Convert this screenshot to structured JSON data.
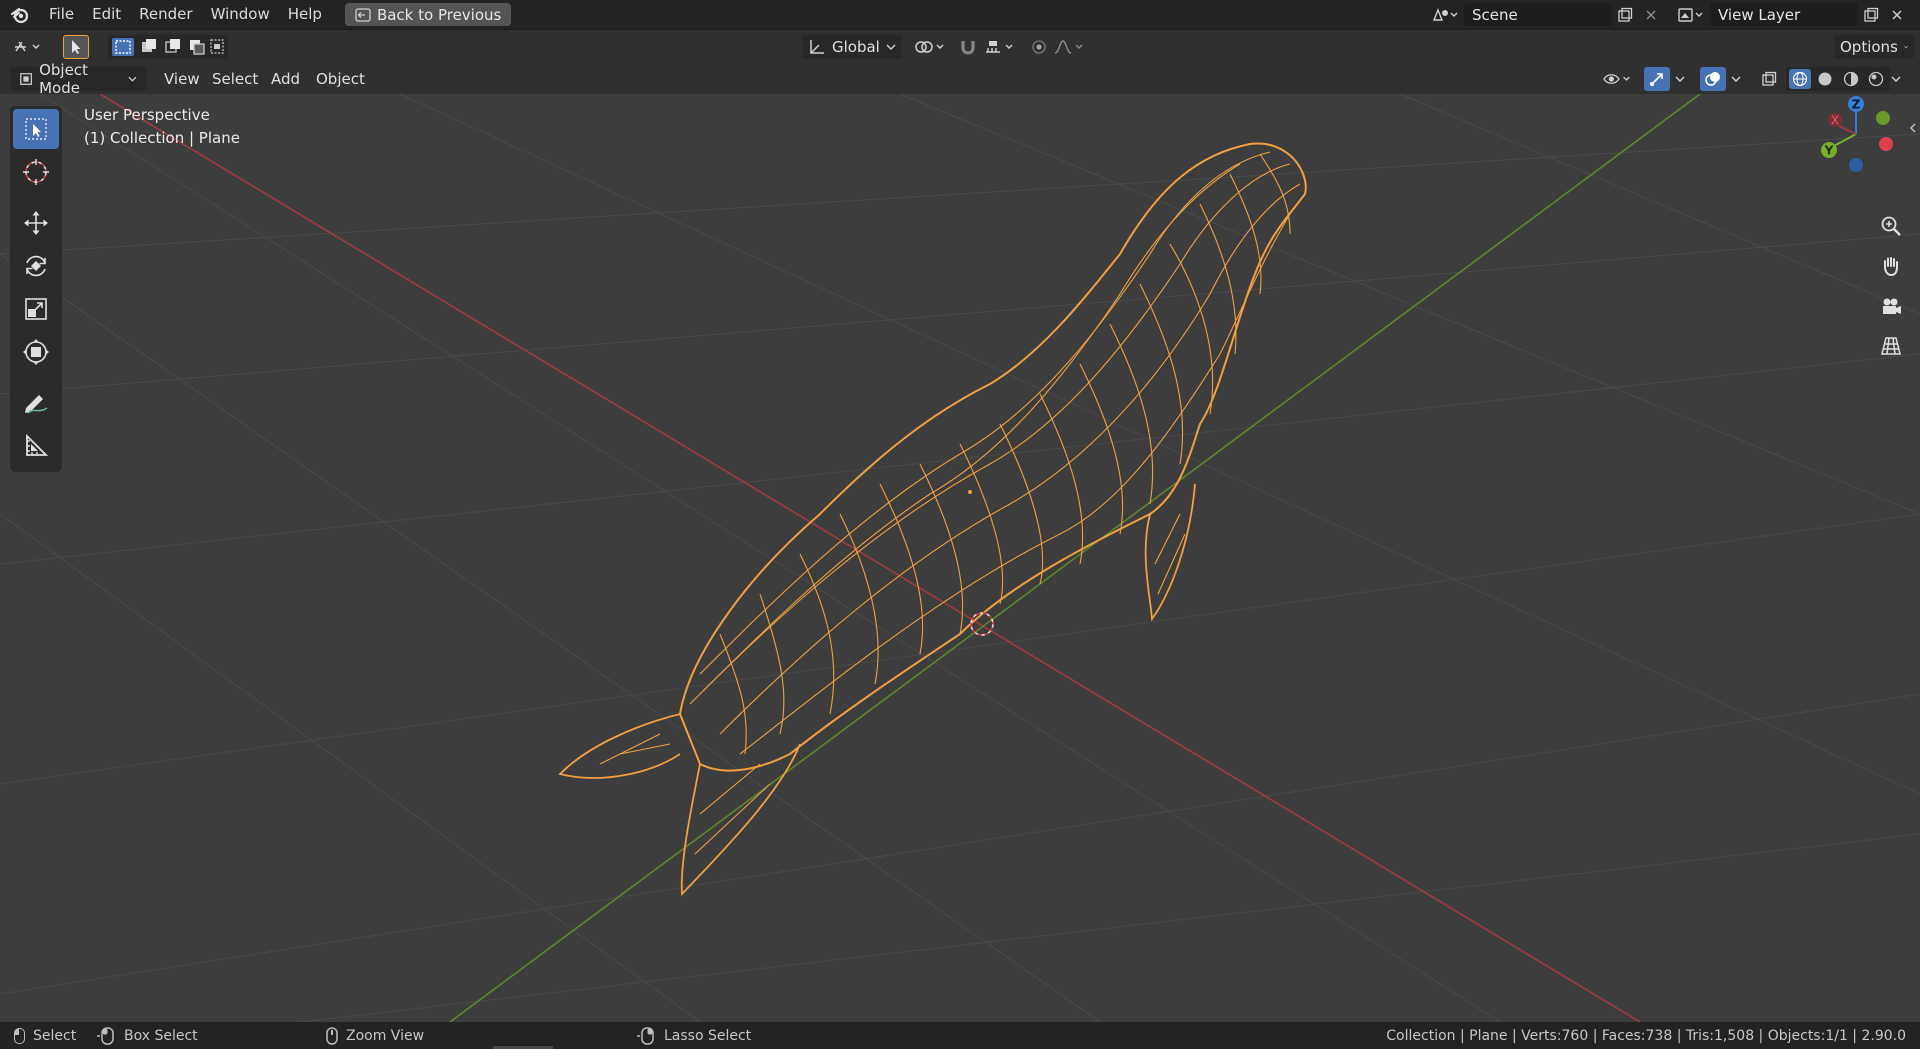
{
  "menubar": {
    "items": [
      "File",
      "Edit",
      "Render",
      "Window",
      "Help"
    ],
    "back_button": "Back to Previous",
    "scene": "Scene",
    "view_layer": "View Layer"
  },
  "tool_settings": {
    "orientation": "Global",
    "options_label": "Options"
  },
  "header": {
    "mode": "Object Mode",
    "menus": [
      "View",
      "Select",
      "Add",
      "Object"
    ]
  },
  "viewport": {
    "perspective_label": "User Perspective",
    "collection_label": "(1) Collection | Plane",
    "gizmo": {
      "x": "X",
      "y": "Y",
      "z": "Z"
    }
  },
  "statusbar": {
    "select": "Select",
    "box_select": "Box Select",
    "zoom_view": "Zoom View",
    "lasso_select": "Lasso Select",
    "stats": "Collection | Plane | Verts:760 | Faces:738 | Tris:1,508 | Objects:1/1 | 2.90.0"
  },
  "colors": {
    "selection_orange": "#f0a040",
    "axis_x": "#c8414b",
    "axis_y": "#6a9a2a",
    "active_tool": "#4772b3"
  }
}
